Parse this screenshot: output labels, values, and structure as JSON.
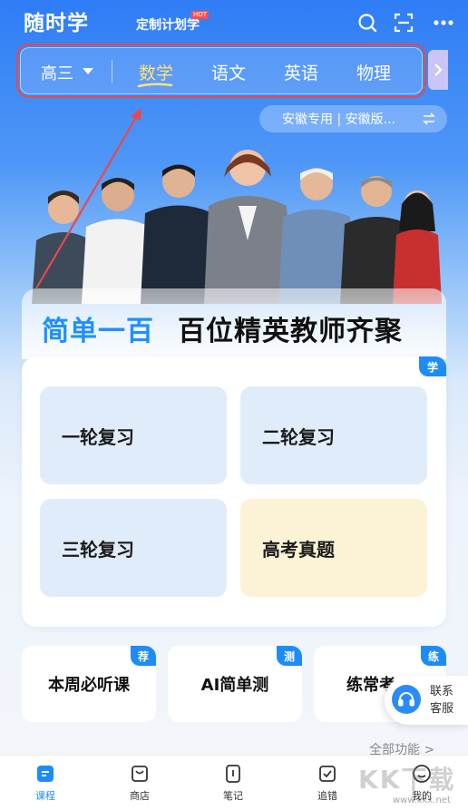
{
  "header": {
    "app_title": "随时学",
    "plan_link": "定制计划学",
    "hot_badge": "HOT",
    "icons": [
      "search-icon",
      "scan-icon",
      "more-icon"
    ]
  },
  "subject_bar": {
    "grade": "高三",
    "tabs": [
      {
        "label": "数学",
        "active": true
      },
      {
        "label": "语文",
        "active": false
      },
      {
        "label": "英语",
        "active": false
      },
      {
        "label": "物理",
        "active": false
      }
    ],
    "active_color": "#ffe27a",
    "highlight_border_color": "#e8484d"
  },
  "region": {
    "label": "安徽专用 | 安徽版..."
  },
  "banner": {
    "brand": "简单一百",
    "slogan": "百位精英教师齐聚"
  },
  "review_section": {
    "badge": "学",
    "tiles": [
      {
        "label": "一轮复习"
      },
      {
        "label": "二轮复习"
      },
      {
        "label": "三轮复习"
      },
      {
        "label": "高考真题"
      }
    ]
  },
  "quick_links": [
    {
      "label": "本周必听课",
      "badge": "荐"
    },
    {
      "label": "AI简单测",
      "badge": "测"
    },
    {
      "label": "练常考",
      "badge": "练"
    }
  ],
  "contact": {
    "line1": "联系",
    "line2": "客服"
  },
  "all_features": "全部功能 >",
  "bottom_nav": [
    {
      "label": "课程",
      "icon": "course-icon",
      "active": true
    },
    {
      "label": "商店",
      "icon": "shop-icon",
      "active": false
    },
    {
      "label": "笔记",
      "icon": "notes-icon",
      "active": false
    },
    {
      "label": "追错",
      "icon": "mistakes-icon",
      "active": false
    },
    {
      "label": "我的",
      "icon": "profile-icon",
      "active": false
    }
  ],
  "watermark": {
    "text": "KK下载",
    "url": "www.kkx.net"
  },
  "colors": {
    "brand_blue": "#1e8cf7",
    "accent_red": "#e8484d"
  }
}
